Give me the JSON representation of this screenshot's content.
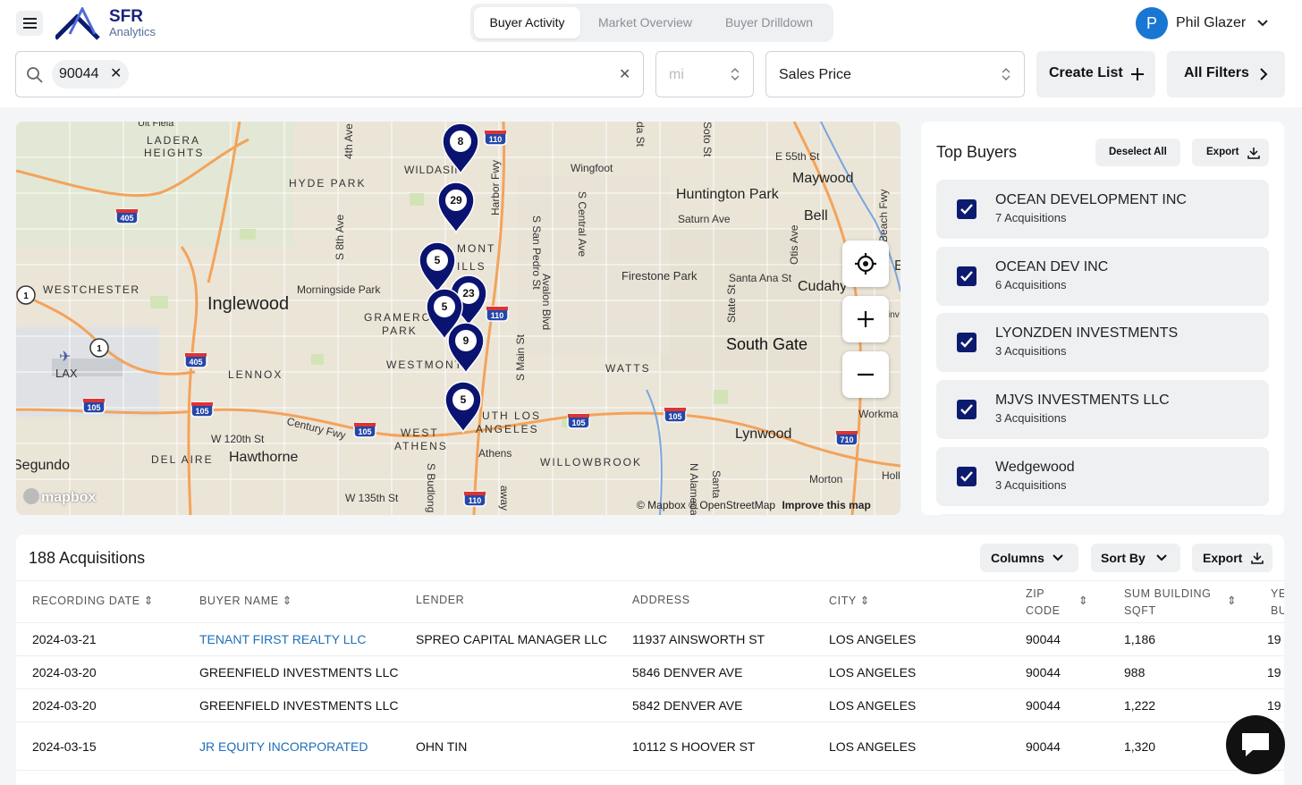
{
  "header": {
    "menu_icon": "hamburger-menu-icon",
    "logo_title": "SFR",
    "logo_subtitle": "Analytics",
    "tabs": [
      {
        "label": "Buyer Activity",
        "active": true
      },
      {
        "label": "Market Overview",
        "active": false
      },
      {
        "label": "Buyer Drilldown",
        "active": false
      }
    ],
    "user": {
      "initial": "P",
      "name": "Phil Glazer"
    }
  },
  "filters": {
    "search_chip": "90044",
    "radius_placeholder": "mi",
    "sort_select": "Sales Price",
    "create_list_label": "Create List",
    "all_filters_label": "All Filters"
  },
  "map": {
    "labels": {
      "ladera": "LADERA",
      "heights": "HEIGHTS",
      "hyde_park": "HYDE PARK",
      "wildasin": "WILDASIN",
      "inglewood": "Inglewood",
      "westchester": "WESTCHESTER",
      "morningside": "Morningside Park",
      "gramercy": "GRAMERCY",
      "park": "PARK",
      "westmont": "WESTMONT",
      "lennox": "LENNOX",
      "lax": "LAX",
      "huntington_park": "Huntington Park",
      "maywood": "Maywood",
      "bell": "Bell",
      "firestone": "Firestone Park",
      "cudahy": "Cudahy",
      "south_gate": "South Gate",
      "watts": "WATTS",
      "lynwood": "Lynwood",
      "willowbrook": "WILLOWBROOK",
      "athens": "Athens",
      "west_athens_1": "WEST",
      "west_athens_2": "ATHENS",
      "south_los_1": "UTH LOS",
      "south_los_2": "ANGELES",
      "hawthorne": "Hawthorne",
      "del_aire": "DEL AIRE",
      "segundo": "Segundo",
      "w120": "W 120th St",
      "w135": "W 135th St",
      "century": "Century Fwy",
      "wingfoot": "Wingfoot",
      "e55": "E 55th St",
      "saturn": "Saturn Ave",
      "santa_ana": "Santa Ana St",
      "workman": "Workma",
      "morton": "Morton",
      "holl": "Holl",
      "e_letter": "E",
      "inv": "inv",
      "fourth_ave": "4th Ave",
      "s8th": "S 8th Ave",
      "harbor": "Harbor Fwy",
      "s_san_pedro": "S San Pedro St",
      "s_central": "S Central Ave",
      "avalon": "Avalon Blvd",
      "s_main": "S Main St",
      "state_st": "State St",
      "otis": "Otis Ave",
      "beach": "Beach Fwy",
      "soto": "Soto St",
      "da_st": "da St",
      "s_budlong": "S Budlong",
      "n_alameda": "N Alameda",
      "santa": "Santa",
      "wayt": "away",
      "mont": "MONT",
      "hills": "ILLS",
      "top_cut": "Uit Fiela"
    },
    "shields": [
      "110",
      "405",
      "405",
      "105",
      "105",
      "105",
      "105",
      "105",
      "110",
      "110",
      "110",
      "710",
      "1",
      "1"
    ],
    "markers": [
      "8",
      "29",
      "5",
      "23",
      "5",
      "9",
      "5"
    ],
    "attribution": "© Mapbox © OpenStreetMap",
    "improve": "Improve this map",
    "brand": "mapbox",
    "controls": [
      "locate-icon",
      "zoom-in-icon",
      "zoom-out-icon"
    ]
  },
  "top_buyers": {
    "title": "Top Buyers",
    "deselect_label": "Deselect All",
    "export_label": "Export",
    "items": [
      {
        "name": "OCEAN DEVELOPMENT INC",
        "count": "7 Acquisitions"
      },
      {
        "name": "OCEAN DEV INC",
        "count": "6 Acquisitions"
      },
      {
        "name": "LYONZDEN INVESTMENTS",
        "count": "3 Acquisitions"
      },
      {
        "name": "MJVS INVESTMENTS LLC",
        "count": "3 Acquisitions"
      },
      {
        "name": "Wedgewood",
        "count": "3 Acquisitions"
      }
    ]
  },
  "acquisitions": {
    "title": "188 Acquisitions",
    "columns_label": "Columns",
    "sort_label": "Sort By",
    "export_label": "Export",
    "headers": {
      "date": "RECORDING DATE",
      "buyer": "BUYER NAME",
      "lender": "LENDER",
      "address": "ADDRESS",
      "city": "CITY",
      "zip1": "ZIP",
      "zip2": "CODE",
      "sqft1": "SUM BUILDING",
      "sqft2": "SQFT",
      "year1": "YE",
      "year2": "BU"
    },
    "rows": [
      {
        "date": "2024-03-21",
        "buyer": "TENANT FIRST REALTY LLC",
        "lender": "SPREO CAPITAL MANAGER LLC",
        "address": "11937 AINSWORTH ST",
        "city": "LOS ANGELES",
        "zip": "90044",
        "sqft": "1,186",
        "year": "19"
      },
      {
        "date": "2024-03-20",
        "buyer": "GREENFIELD INVESTMENTS LLC",
        "lender": "",
        "address": "5846 DENVER AVE",
        "city": "LOS ANGELES",
        "zip": "90044",
        "sqft": "988",
        "year": "19"
      },
      {
        "date": "2024-03-20",
        "buyer": "GREENFIELD INVESTMENTS LLC",
        "lender": "",
        "address": "5842 DENVER AVE",
        "city": "LOS ANGELES",
        "zip": "90044",
        "sqft": "1,222",
        "year": "19"
      },
      {
        "date": "2024-03-15",
        "buyer": "JR EQUITY INCORPORATED",
        "lender": "OHN TIN",
        "address": "10112 S HOOVER ST",
        "city": "LOS ANGELES",
        "zip": "90044",
        "sqft": "1,320",
        "year": ""
      }
    ]
  },
  "colors": {
    "brand_navy": "#0d1b6e",
    "link": "#1e6fb8",
    "avatar": "#1976d2"
  }
}
